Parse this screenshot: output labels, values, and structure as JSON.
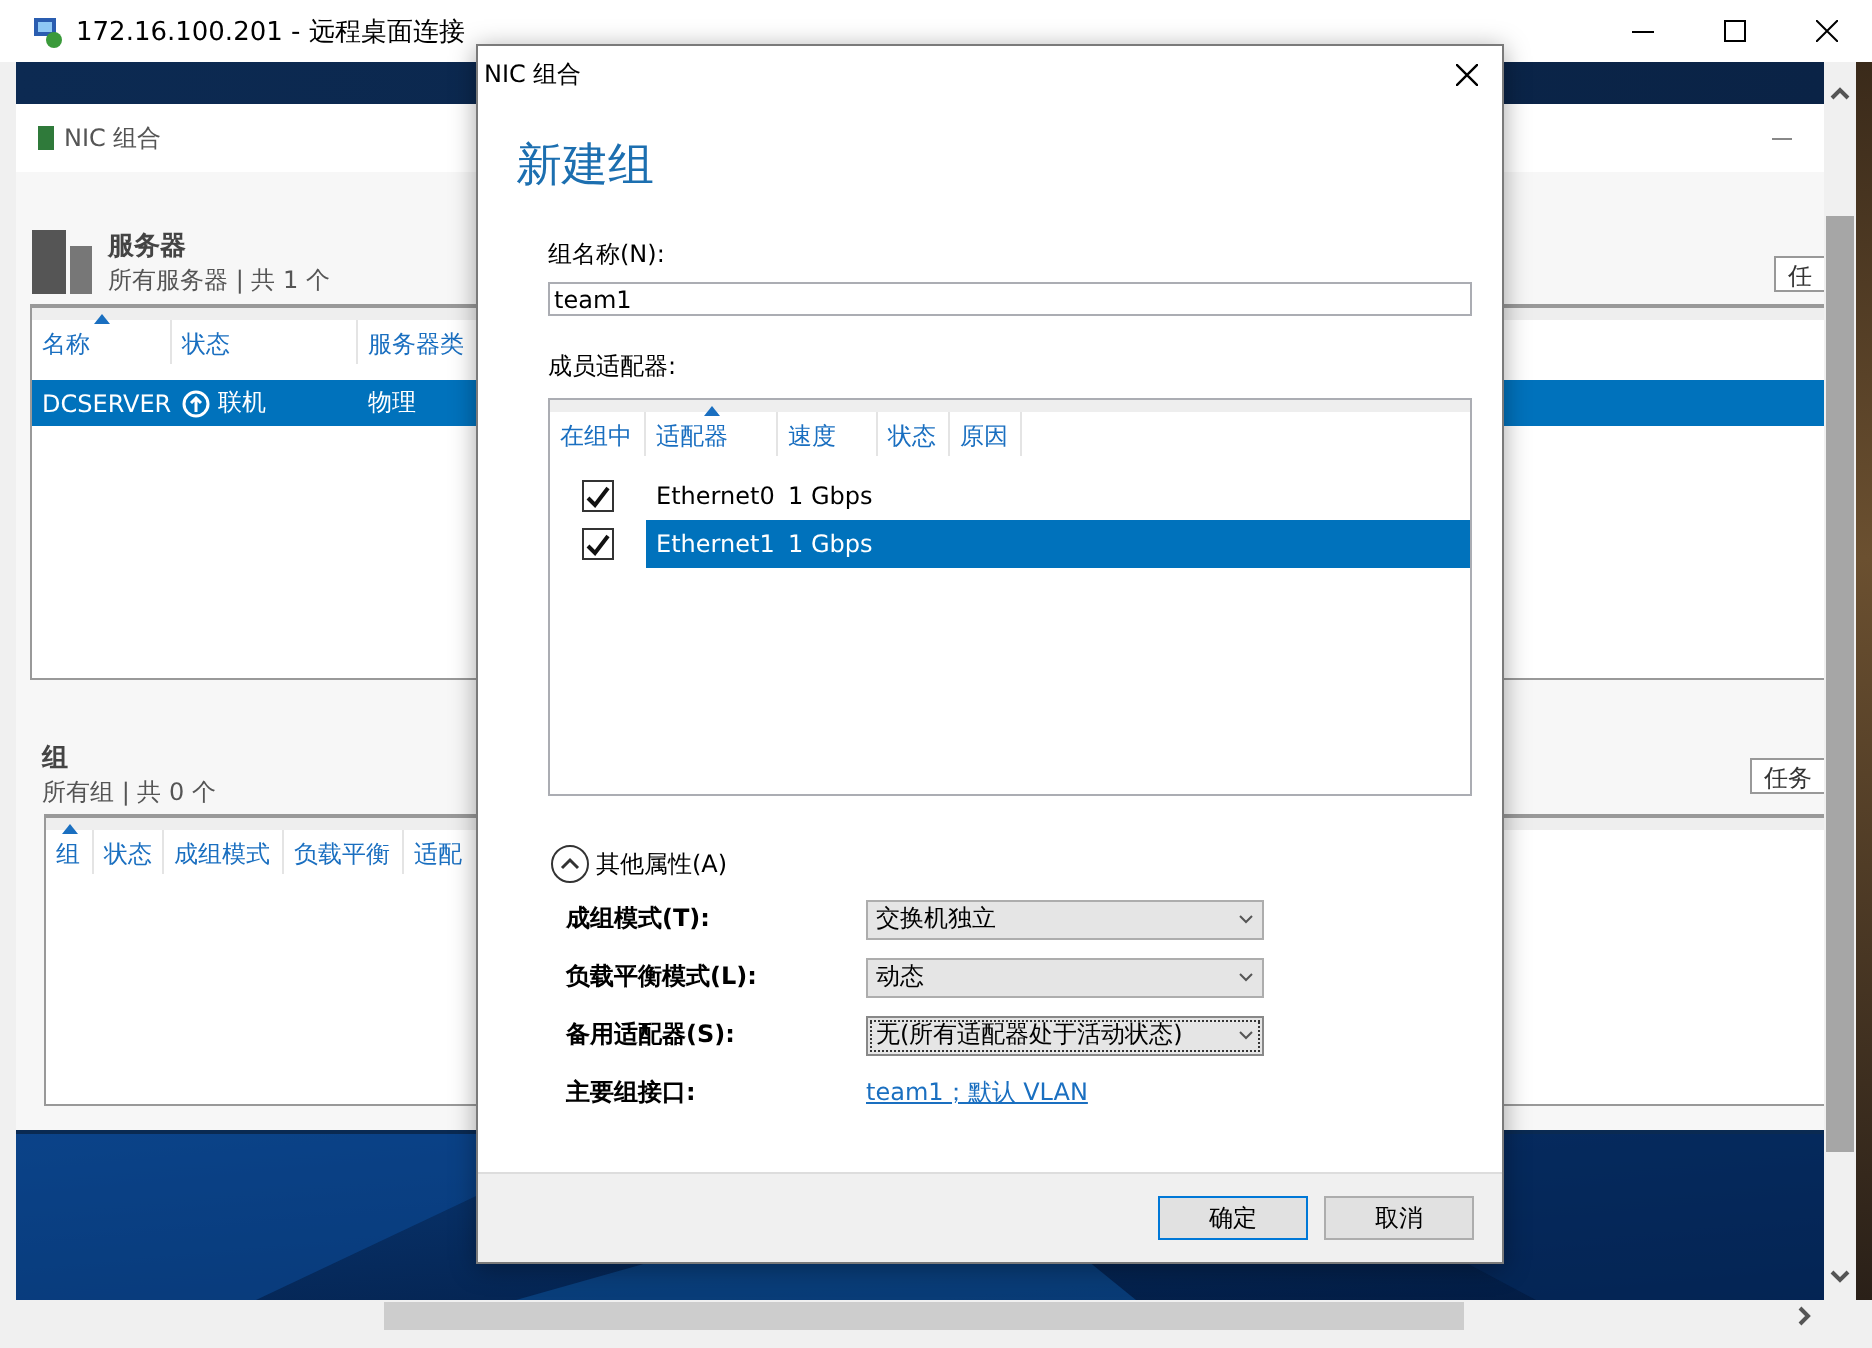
{
  "window": {
    "title": "172.16.100.201 - 远程桌面连接"
  },
  "remote": {
    "app_title": "NIC 组合",
    "servers": {
      "title": "服务器",
      "subtitle": "所有服务器 | 共 1 个",
      "tasks_button": "任",
      "columns": [
        {
          "label": "名称",
          "sorted": true
        },
        {
          "label": "状态",
          "sorted": false
        },
        {
          "label": "服务器类",
          "sorted": false
        }
      ],
      "rows": [
        {
          "cells": [
            "DCSERVER",
            "联机",
            "物理"
          ],
          "selected": true
        }
      ]
    },
    "groups": {
      "title": "组",
      "subtitle": "所有组 | 共 0 个",
      "tasks_button": "任务",
      "columns": [
        {
          "label": "组",
          "sorted": true
        },
        {
          "label": "状态",
          "sorted": false
        },
        {
          "label": "成组模式",
          "sorted": false
        },
        {
          "label": "负载平衡",
          "sorted": false
        },
        {
          "label": "适配",
          "sorted": false
        }
      ]
    }
  },
  "dialog": {
    "title": "NIC 组合",
    "heading": "新建组",
    "name_label": "组名称(N):",
    "name_value": "team1",
    "members_label": "成员适配器:",
    "member_columns": [
      {
        "label": "在组中",
        "sorted": false
      },
      {
        "label": "适配器",
        "sorted": true
      },
      {
        "label": "速度",
        "sorted": false
      },
      {
        "label": "状态",
        "sorted": false
      },
      {
        "label": "原因",
        "sorted": false
      }
    ],
    "members": [
      {
        "checked": true,
        "adapter": "Ethernet0",
        "speed": "1 Gbps",
        "selected": false
      },
      {
        "checked": true,
        "adapter": "Ethernet1",
        "speed": "1 Gbps",
        "selected": true
      }
    ],
    "properties": {
      "label": "其他属性(A)",
      "expanded": true,
      "rows": [
        {
          "kind": "dropdown",
          "label": "成组模式(T):",
          "value": "交换机独立",
          "focused": false
        },
        {
          "kind": "dropdown",
          "label": "负载平衡模式(L):",
          "value": "动态",
          "focused": false
        },
        {
          "kind": "dropdown",
          "label": "备用适配器(S):",
          "value": "无(所有适配器处于活动状态)",
          "focused": true
        },
        {
          "kind": "link",
          "label": "主要组接口:",
          "value": "team1；默认 VLAN"
        }
      ]
    },
    "buttons": [
      {
        "label": "确定",
        "default": true
      },
      {
        "label": "取消",
        "default": false
      }
    ]
  }
}
